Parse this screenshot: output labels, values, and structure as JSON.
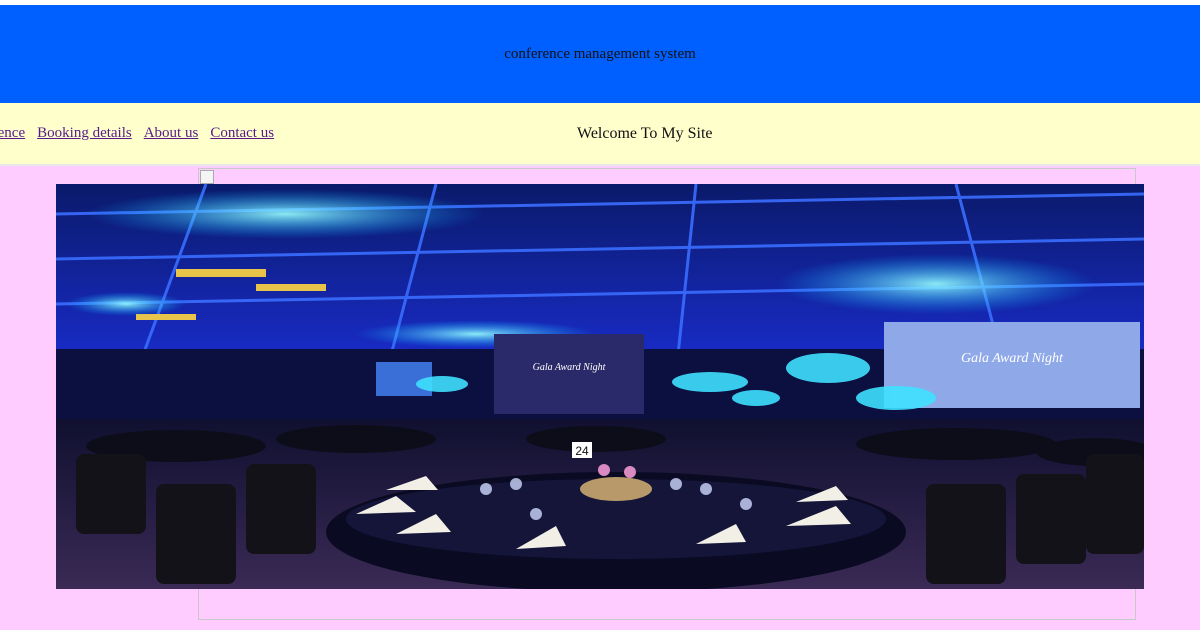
{
  "header": {
    "title": "conference management system"
  },
  "nav": {
    "items": [
      {
        "label": "erence"
      },
      {
        "label": "Booking details"
      },
      {
        "label": "About us"
      },
      {
        "label": "Contact us"
      }
    ]
  },
  "welcome": {
    "text": "Welcome To My Site"
  },
  "hero": {
    "screen_text_left": "Gala Award Night",
    "screen_text_right": "Gala Award Night",
    "table_number": "24"
  },
  "colors": {
    "header_bg": "#0060ff",
    "navbar_bg": "#ffffcc",
    "content_bg": "#ffccff",
    "link_color": "#551a8b"
  }
}
